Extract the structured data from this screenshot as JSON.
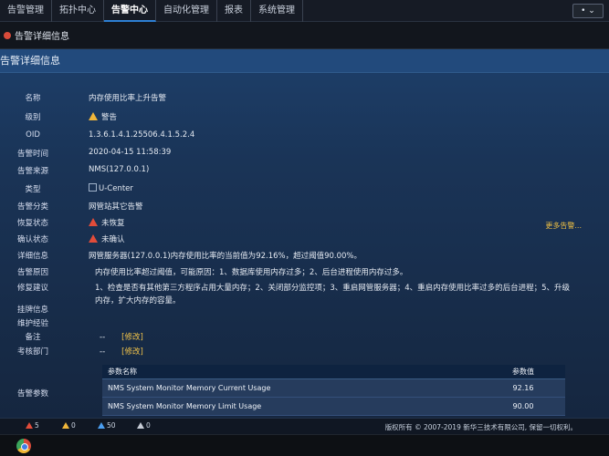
{
  "topnav": {
    "items": [
      "告警管理",
      "拓扑中心",
      "告警中心",
      "自动化管理",
      "报表",
      "系统管理"
    ],
    "user": "• ⌄"
  },
  "breadcrumb": {
    "title": "告警详细信息"
  },
  "panel": {
    "title": "告警详细信息"
  },
  "details": [
    {
      "label": "名称",
      "value": "内存使用比率上升告警"
    },
    {
      "label": "级别",
      "value": "警告"
    },
    {
      "label": "OID",
      "value": "1.3.6.1.4.1.25506.4.1.5.2.4"
    },
    {
      "label": "告警时间",
      "value": "2020-04-15 11:58:39"
    },
    {
      "label": "告警来源",
      "value": "NMS(127.0.0.1)"
    },
    {
      "label": "类型",
      "value": "U-Center"
    },
    {
      "label": "告警分类",
      "value": "网管站其它告警"
    },
    {
      "label": "恢复状态",
      "value": "未恢复"
    },
    {
      "label": "确认状态",
      "value": "未确认"
    },
    {
      "label": "详细信息",
      "value": "网管服务器(127.0.0.1)内存使用比率的当前值为92.16%，超过阈值90.00%。"
    },
    {
      "label": "告警原因",
      "value": "内存使用比率超过阈值，可能原因：1、数据库使用内存过多；2、后台进程使用内存过多。"
    },
    {
      "label": "修复建议",
      "value": "1、检查是否有其他第三方程序占用大量内存；2、关闭部分监控项；3、重启网管服务器；4、重启内存使用比率过多的后台进程；5、升级内存，扩大内存的容量。"
    },
    {
      "label": "挂牌信息",
      "value": ""
    },
    {
      "label": "维护经验",
      "value": ""
    },
    {
      "label": "备注",
      "value": "--",
      "edit": "[修改]"
    },
    {
      "label": "考核部门",
      "value": "--",
      "edit": "[修改]"
    }
  ],
  "more_link": "更多告警...",
  "params": {
    "label": "告警参数",
    "header": [
      "参数名称",
      "参数值"
    ],
    "rows": [
      {
        "name": "NMS System Monitor Memory Current Usage",
        "value": "92.16"
      },
      {
        "name": "NMS System Monitor Memory Limit Usage",
        "value": "90.00"
      }
    ]
  },
  "footer": {
    "stats": [
      "5",
      "0",
      "50",
      "0"
    ],
    "copyright": "版权所有 © 2007-2019 新华三技术有限公司, 保留一切权利。"
  }
}
